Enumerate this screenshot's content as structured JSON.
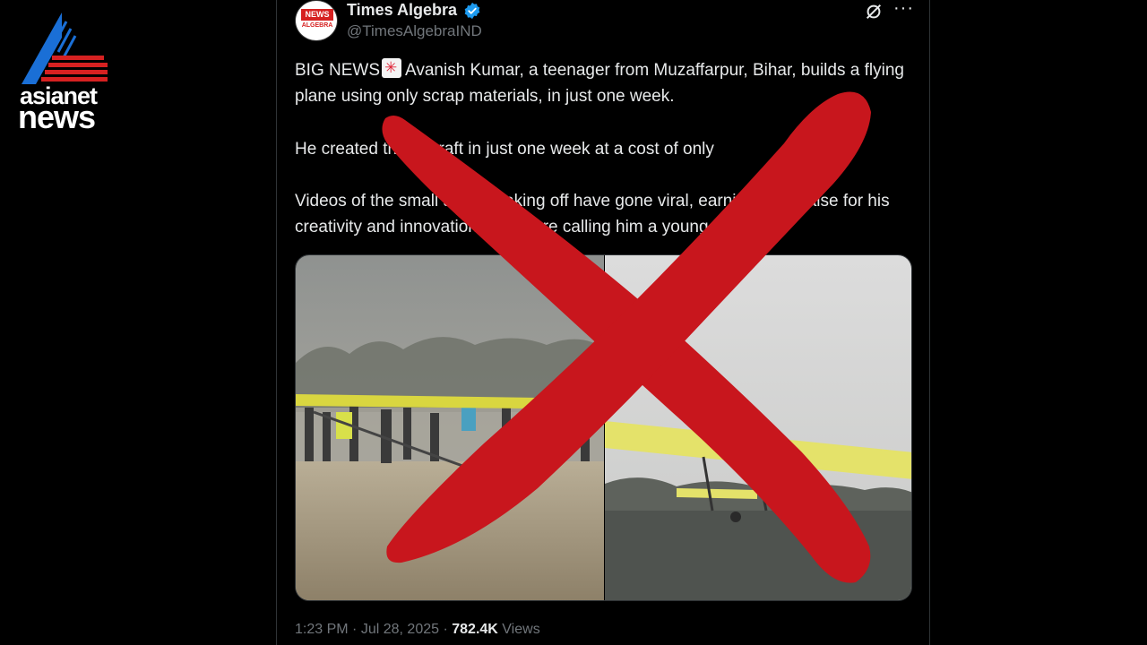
{
  "logo": {
    "line1": "asianet",
    "line2": "news"
  },
  "tweet": {
    "avatar": {
      "top": "NEWS",
      "bottom": "ALGEBRA"
    },
    "display_name": "Times Algebra",
    "handle": "@TimesAlgebraIND",
    "paragraphs": {
      "p1_before_emoji": "BIG NEWS",
      "p1_after_emoji": "Avanish Kumar, a teenager from Muzaffarpur, Bihar, builds a flying plane using only scrap materials, in just one week.",
      "p2": "He created the aircraft in just one week at a cost of only",
      "p3": "Videos of the small aircraft taking off have gone viral, earning him praise for his creativity and innovation. Many are calling him a young genius"
    },
    "icons": {
      "siren": "police-light-emoji",
      "fire": "fire-emoji",
      "grok": "grok-icon",
      "more": "more-icon",
      "verified": "verified-badge-icon"
    },
    "footer": {
      "time": "1:23 PM",
      "date": "Jul 28, 2025",
      "views_count": "782.4K",
      "views_label": "Views"
    }
  },
  "overlay": {
    "symbol": "red-x-mark",
    "color": "#c8161d"
  },
  "colors": {
    "verified": "#1d9bf0",
    "brand_red": "#d62121",
    "logo_blue": "#1a6fd6"
  }
}
